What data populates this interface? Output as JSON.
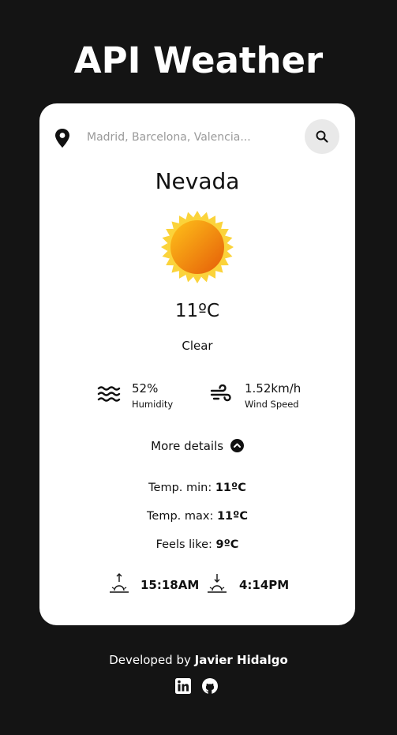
{
  "header": {
    "title": "API Weather"
  },
  "search": {
    "placeholder": "Madrid, Barcelona, Valencia..."
  },
  "weather": {
    "city": "Nevada",
    "icon": "sun-icon",
    "temperature": "11ºC",
    "condition": "Clear",
    "humidity": {
      "value": "52%",
      "label": "Humidity",
      "icon": "humidity-waves-icon"
    },
    "wind": {
      "value": "1.52km/h",
      "label": "Wind Speed",
      "icon": "wind-icon"
    }
  },
  "details": {
    "toggle_label": "More details",
    "temp_min_label": "Temp. min:",
    "temp_min_value": "11ºC",
    "temp_max_label": "Temp. max:",
    "temp_max_value": "11ºC",
    "feels_like_label": "Feels like:",
    "feels_like_value": "9ºC",
    "sunrise": "15:18AM",
    "sunset": "4:14PM"
  },
  "footer": {
    "credit_prefix": "Developed by",
    "author": "Javier Hidalgo",
    "links": [
      "linkedin-icon",
      "github-icon"
    ]
  },
  "colors": {
    "background": "#141414",
    "card": "#ffffff",
    "search_button": "#e9e9e9",
    "sun_outer": "#f8c11a",
    "sun_inner": "#ea6a0a"
  }
}
